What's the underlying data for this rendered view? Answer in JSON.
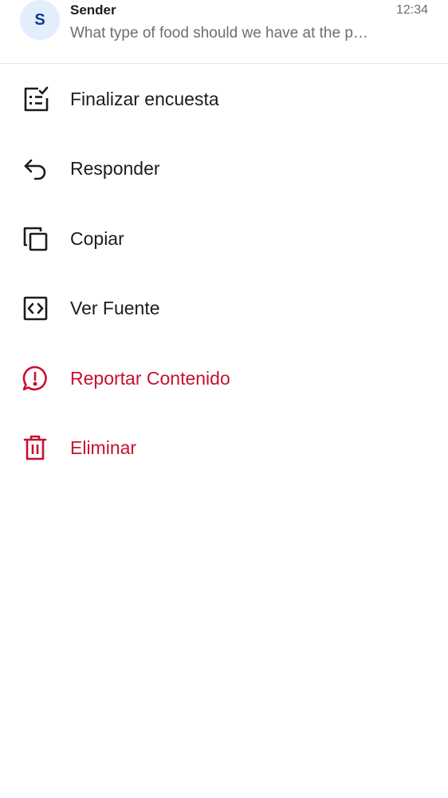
{
  "message": {
    "avatar_initial": "S",
    "sender": "Sender",
    "preview": "What type of food should we have at the party?",
    "time": "12:34"
  },
  "colors": {
    "text": "#1c1c1c",
    "muted": "#6b6e73",
    "danger": "#c8102e",
    "avatar_bg": "#e3eefc",
    "avatar_fg": "#0b3d8f"
  },
  "menu": {
    "items": [
      {
        "label": "Finalizar encuesta",
        "icon": "poll-end-icon"
      },
      {
        "label": "Responder",
        "icon": "reply-icon"
      },
      {
        "label": "Copiar",
        "icon": "copy-icon"
      },
      {
        "label": "Ver Fuente",
        "icon": "view-source-icon"
      },
      {
        "label": "Reportar Contenido",
        "icon": "report-icon"
      },
      {
        "label": "Eliminar",
        "icon": "delete-icon"
      }
    ]
  }
}
